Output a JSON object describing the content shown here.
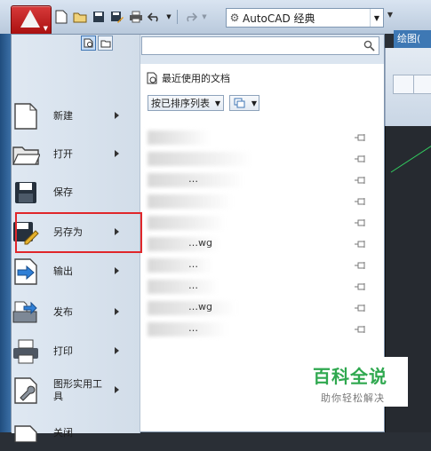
{
  "quick_access": {
    "workspace": "AutoCAD 经典"
  },
  "drawing_tab": "绘图(",
  "menu": {
    "search_placeholder": "",
    "items": [
      {
        "label": "新建",
        "has_submenu": true,
        "icon": "new-file-icon"
      },
      {
        "label": "打开",
        "has_submenu": true,
        "icon": "open-folder-icon"
      },
      {
        "label": "保存",
        "has_submenu": false,
        "icon": "save-disk-icon"
      },
      {
        "label": "另存为",
        "has_submenu": true,
        "icon": "save-as-icon"
      },
      {
        "label": "输出",
        "has_submenu": true,
        "icon": "export-icon"
      },
      {
        "label": "发布",
        "has_submenu": true,
        "icon": "publish-icon"
      },
      {
        "label": "打印",
        "has_submenu": true,
        "icon": "print-icon"
      },
      {
        "label": "图形实用工具",
        "has_submenu": true,
        "icon": "drawing-utilities-icon"
      },
      {
        "label": "关闭",
        "has_submenu": true,
        "icon": "close-icon"
      }
    ]
  },
  "recent": {
    "title": "最近使用的文档",
    "sort_label": "按已排序列表",
    "docs": [
      {
        "name": ""
      },
      {
        "name": ""
      },
      {
        "name": "…"
      },
      {
        "name": ""
      },
      {
        "name": ""
      },
      {
        "name": "…wg"
      },
      {
        "name": "…"
      },
      {
        "name": "…"
      },
      {
        "name": "…wg"
      },
      {
        "name": "…"
      }
    ]
  },
  "watermark": {
    "title": "百科全说",
    "subtitle": "助你轻松解决"
  }
}
